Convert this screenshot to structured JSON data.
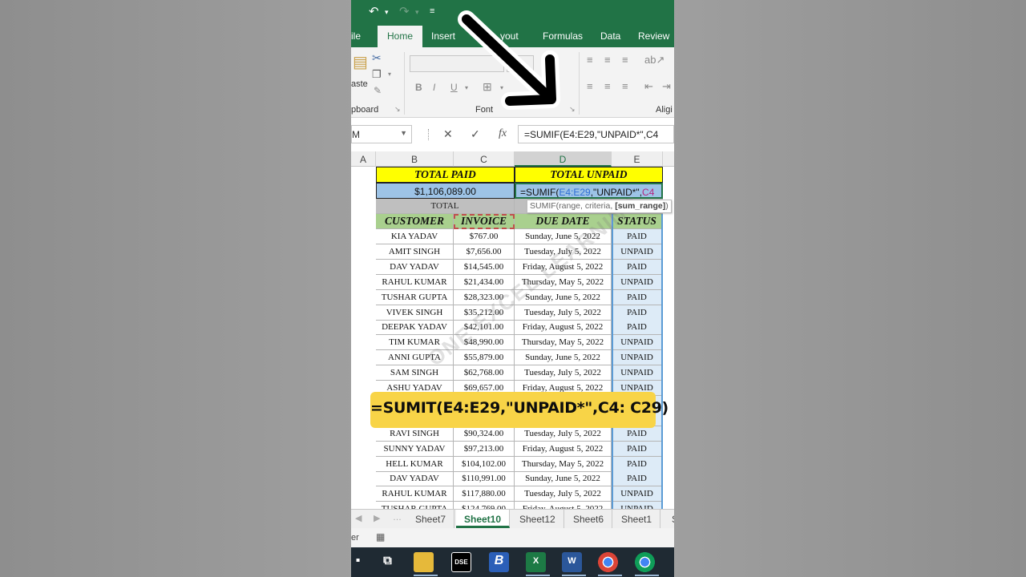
{
  "ribbon": {
    "tabs": [
      "ile",
      "Home",
      "Insert",
      "yout",
      "Formulas",
      "Data",
      "Review"
    ],
    "active_tab": "Home",
    "groups": {
      "clipboard": "pboard",
      "font": "Font",
      "align": "Aligi"
    },
    "paste_label": "aste"
  },
  "formula_bar": {
    "name_box": "M",
    "cancel": "✕",
    "enter": "✓",
    "fx": "fx",
    "formula": "=SUMIF(E4:E29,\"UNPAID*\",C4"
  },
  "columns": [
    "A",
    "B",
    "C",
    "D",
    "E"
  ],
  "sheet": {
    "total_paid_label": "TOTAL PAID",
    "total_unpaid_label": "TOTAL UNPAID",
    "total_paid_value": "$1,106,089.00",
    "edit_prefix": "=SUMIF(",
    "edit_range": "E4:E29",
    "edit_mid": ",\"UNPAID*\",",
    "edit_ref": "C4",
    "total_row_label": "TOTAL",
    "tooltip_prefix": "SUMIF(range, criteria, ",
    "tooltip_bold": "[sum_range]",
    "tooltip_suffix": ")",
    "headers": {
      "customer": "CUSTOMER",
      "invoice": "INVOICE",
      "due_date": "DUE DATE",
      "status": "STATUS"
    },
    "rows": [
      {
        "customer": "KIA YADAV",
        "invoice": "$767.00",
        "due": "Sunday, June 5, 2022",
        "status": "PAID"
      },
      {
        "customer": "AMIT SINGH",
        "invoice": "$7,656.00",
        "due": "Tuesday, July 5, 2022",
        "status": "UNPAID"
      },
      {
        "customer": "DAV YADAV",
        "invoice": "$14,545.00",
        "due": "Friday, August 5, 2022",
        "status": "PAID"
      },
      {
        "customer": "RAHUL KUMAR",
        "invoice": "$21,434.00",
        "due": "Thursday, May 5, 2022",
        "status": "UNPAID"
      },
      {
        "customer": "TUSHAR GUPTA",
        "invoice": "$28,323.00",
        "due": "Sunday, June 5, 2022",
        "status": "PAID"
      },
      {
        "customer": "VIVEK SINGH",
        "invoice": "$35,212.00",
        "due": "Tuesday, July 5, 2022",
        "status": "PAID"
      },
      {
        "customer": "DEEPAK YADAV",
        "invoice": "$42,101.00",
        "due": "Friday, August 5, 2022",
        "status": "PAID"
      },
      {
        "customer": "TIM KUMAR",
        "invoice": "$48,990.00",
        "due": "Thursday, May 5, 2022",
        "status": "UNPAID"
      },
      {
        "customer": "ANNI GUPTA",
        "invoice": "$55,879.00",
        "due": "Sunday, June 5, 2022",
        "status": "UNPAID"
      },
      {
        "customer": "SAM SINGH",
        "invoice": "$62,768.00",
        "due": "Tuesday, July 5, 2022",
        "status": "UNPAID"
      },
      {
        "customer": "ASHU YADAV",
        "invoice": "$69,657.00",
        "due": "Friday, August 5, 2022",
        "status": "UNPAID"
      },
      {
        "customer": "",
        "invoice": "",
        "due": "",
        "status": ""
      },
      {
        "customer": "",
        "invoice": "",
        "due": "",
        "status": ""
      },
      {
        "customer": "RAVI SINGH",
        "invoice": "$90,324.00",
        "due": "Tuesday, July 5, 2022",
        "status": "PAID"
      },
      {
        "customer": "SUNNY YADAV",
        "invoice": "$97,213.00",
        "due": "Friday, August 5, 2022",
        "status": "PAID"
      },
      {
        "customer": "HELL KUMAR",
        "invoice": "$104,102.00",
        "due": "Thursday, May 5, 2022",
        "status": "PAID"
      },
      {
        "customer": "DAV YADAV",
        "invoice": "$110,991.00",
        "due": "Sunday, June 5, 2022",
        "status": "PAID"
      },
      {
        "customer": "RAHUL KUMAR",
        "invoice": "$117,880.00",
        "due": "Tuesday, July 5, 2022",
        "status": "UNPAID"
      },
      {
        "customer": "TUSHAR GUPTA",
        "invoice": "$124,769.00",
        "due": "Friday, August 5, 2022",
        "status": "UNPAID"
      }
    ]
  },
  "watermark": "ONE EXCEL LEARNING",
  "sheet_tabs": [
    "Sheet7",
    "Sheet10",
    "Sheet12",
    "Sheet6",
    "Sheet1",
    "S"
  ],
  "active_sheet": "Sheet10",
  "status_bar": {
    "mode": "er"
  },
  "taskbar": {
    "apps": [
      "task-view",
      "file-explorer",
      "dse",
      "b-app",
      "excel",
      "word",
      "chrome",
      "chrome-alt"
    ],
    "dse_label": "DSE",
    "b_label": "B",
    "excel_label": "X",
    "word_label": "W"
  },
  "caption": "=SUMIT(E4:E29,\"UNPAID*\",C4: C29)",
  "colors": {
    "excel_green": "#217346",
    "header_yellow": "#ffff00",
    "header_green": "#a9d08e",
    "value_blue": "#9dc3e6",
    "caption_yellow": "#f8d447"
  }
}
